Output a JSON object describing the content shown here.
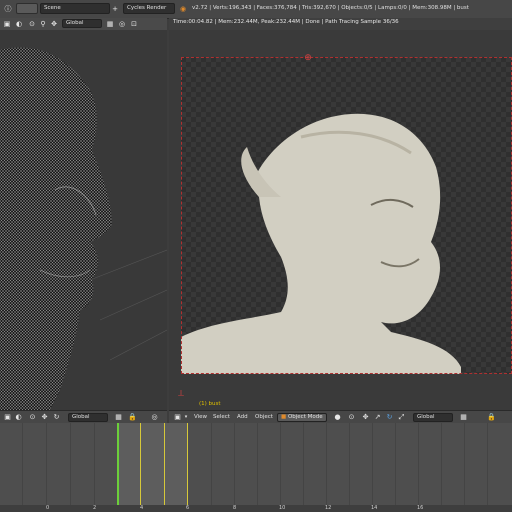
{
  "info_header": {
    "scene_name": "Scene",
    "render_engine": "Cycles Render",
    "stats": "v2.72 | Verts:196,343 | Faces:376,784 | Tris:392,670 | Objects:0/5 | Lamps:0/0 | Mem:308.98M | bust"
  },
  "left_view": {
    "orientation": "Global"
  },
  "right_view": {
    "render_status": "Time:00:04.82 | Mem:232.44M, Peak:232.44M | Done | Path Tracing Sample 36/36",
    "object_label": "(1) bust"
  },
  "bottom_header": {
    "left_orientation": "Global",
    "menu": [
      "View",
      "Select",
      "Add",
      "Object"
    ],
    "mode": "Object Mode",
    "orientation": "Global"
  },
  "timeline": {
    "ticks": [
      "0",
      "2",
      "4",
      "6",
      "8",
      "10",
      "12",
      "14",
      "16"
    ]
  },
  "colors": {
    "current_frame": "#6ccf3a",
    "keyframe": "#d6c83a",
    "render_border": "#b03030"
  }
}
